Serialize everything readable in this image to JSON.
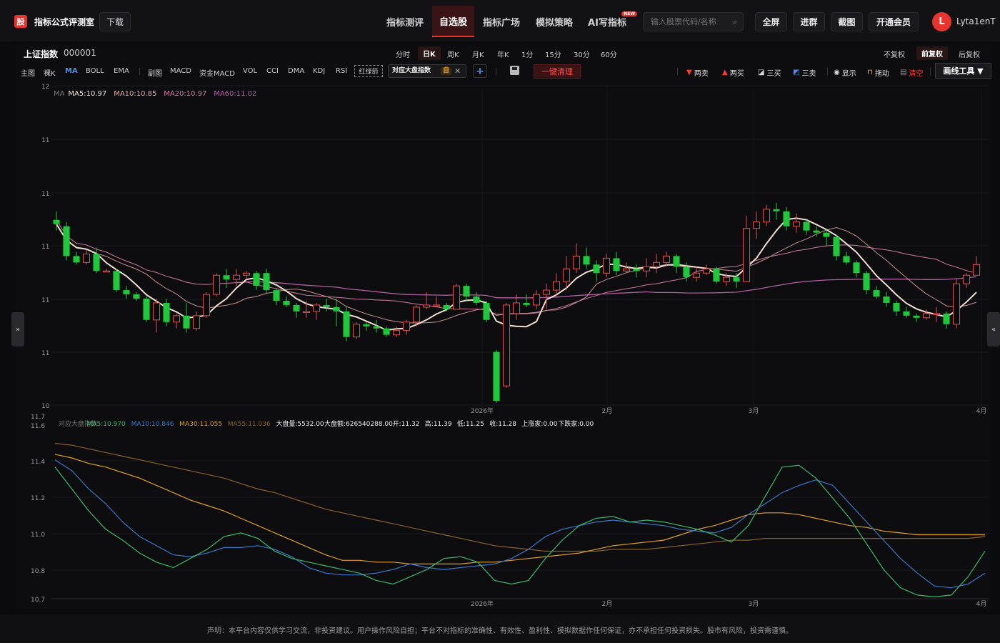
{
  "app": {
    "badge": "股",
    "title": "指标公式评测室",
    "download": "下载"
  },
  "nav": [
    {
      "label": "指标测评",
      "active": false
    },
    {
      "label": "自选股",
      "active": true
    },
    {
      "label": "指标广场",
      "active": false
    },
    {
      "label": "模拟策略",
      "active": false
    },
    {
      "label": "AI写指标",
      "active": false,
      "badge": "NEW"
    }
  ],
  "search": {
    "placeholder": "输入股票代码/名称"
  },
  "top_buttons": [
    "全屏",
    "进群",
    "截图",
    "开通会员"
  ],
  "user": {
    "initial": "L",
    "name": "Lyta1enT"
  },
  "index": {
    "name": "上证指数",
    "code": "000001"
  },
  "periods": [
    {
      "label": "分时",
      "active": false
    },
    {
      "label": "日K",
      "active": true
    },
    {
      "label": "周K",
      "active": false
    },
    {
      "label": "月K",
      "active": false
    },
    {
      "label": "年K",
      "active": false
    },
    {
      "label": "1分",
      "active": false
    },
    {
      "label": "15分",
      "active": false
    },
    {
      "label": "30分",
      "active": false
    },
    {
      "label": "60分",
      "active": false
    }
  ],
  "adjust": [
    {
      "label": "不复权",
      "active": false
    },
    {
      "label": "前复权",
      "active": true
    },
    {
      "label": "后复权",
      "active": false
    }
  ],
  "main_indicators": [
    "主图",
    "裸K",
    "MA",
    "BOLL",
    "EMA"
  ],
  "main_active": "MA",
  "sub_indicators": [
    "副图",
    "MACD",
    "资金MACD",
    "VOL",
    "CCI",
    "DMA",
    "KDJ",
    "RSI"
  ],
  "red_green": "红绿箭",
  "compare_tag": {
    "label": "对应大盘指数",
    "badge": "自"
  },
  "clear_button": "一键清理",
  "tools": [
    {
      "icon": "▼",
      "label": "两卖",
      "color": "#ff3b30"
    },
    {
      "icon": "▲",
      "label": "两买",
      "color": "#ff3b30"
    },
    {
      "icon": "⧄",
      "label": "三买",
      "color": "#ddd"
    },
    {
      "icon": "⧅",
      "label": "三卖",
      "color": "#4d8fe8"
    },
    {
      "icon": "◉",
      "label": "显示",
      "color": "#ddd"
    },
    {
      "icon": "🔓",
      "label": "拖动",
      "color": "#f0c040"
    },
    {
      "icon": "🗑",
      "label": "清空",
      "color": "#ff3b30"
    }
  ],
  "draw_tools": "画线工具 ▼",
  "main_chart": {
    "legend": [
      {
        "label": "MA",
        "color": "#777"
      },
      {
        "label": "MA5:10.97",
        "color": "#f0e0d8"
      },
      {
        "label": "MA10:10.85",
        "color": "#e0a8a8"
      },
      {
        "label": "MA20:10.97",
        "color": "#d07aa0"
      },
      {
        "label": "MA60:11.02",
        "color": "#b060a0"
      }
    ],
    "y_ticks": [
      "12",
      "11",
      "11",
      "11",
      "11",
      "11",
      "10"
    ],
    "x_ticks": [
      "2026年",
      "2月",
      "3月",
      "4月"
    ]
  },
  "sub_chart": {
    "legend": [
      {
        "label": "对应大盘指数",
        "color": "#777"
      },
      {
        "label": "MA5:10.970",
        "color": "#3ab86a"
      },
      {
        "label": "MA10:10.846",
        "color": "#3a78c8"
      },
      {
        "label": "MA30:11.055",
        "color": "#e0a020"
      },
      {
        "label": "MA55:11.036",
        "color": "#8a6030"
      },
      {
        "label": "大盘量:5532.00",
        "color": "#eee"
      },
      {
        "label": "大盘额:626540288.00",
        "color": "#eee"
      },
      {
        "label": "开:11.32",
        "color": "#eee"
      },
      {
        "label": "高:11.39",
        "color": "#eee"
      },
      {
        "label": "低:11.25",
        "color": "#eee"
      },
      {
        "label": "收:11.28",
        "color": "#eee"
      },
      {
        "label": "上涨家:0.00",
        "color": "#eee"
      },
      {
        "label": "下跌家:0.00",
        "color": "#eee"
      }
    ],
    "y_ticks": [
      "11.7",
      "11.6",
      "11.4",
      "11.2",
      "11.0",
      "10.8",
      "10.7"
    ],
    "x_ticks": [
      "2026年",
      "2月",
      "3月",
      "4月"
    ]
  },
  "disclaimer": "声明：本平台内容仅供学习交流，非投资建议。用户操作风险自担；平台不对指标的准确性、有效性、盈利性、模拟数据作任何保证，亦不承担任何投资损失。股市有风险，投资需谨慎。",
  "chart_data": [
    {
      "type": "candlestick",
      "title": "上证指数 000001",
      "y_range": [
        10.5,
        12.0
      ],
      "x_labels": [
        "2026年",
        "2月",
        "3月",
        "4月"
      ],
      "candles": [
        [
          11.37,
          11.35,
          11.41,
          11.32
        ],
        [
          11.34,
          11.2,
          11.36,
          11.18
        ],
        [
          11.2,
          11.17,
          11.22,
          11.16
        ],
        [
          11.17,
          11.21,
          11.23,
          11.16
        ],
        [
          11.21,
          11.13,
          11.24,
          11.12
        ],
        [
          11.13,
          11.13,
          11.14,
          11.13
        ],
        [
          11.13,
          11.04,
          11.14,
          11.03
        ],
        [
          11.04,
          11.02,
          11.06,
          11.0
        ],
        [
          11.02,
          11.0,
          11.03,
          10.99
        ],
        [
          11.0,
          10.9,
          11.01,
          10.89
        ],
        [
          10.9,
          10.98,
          11.0,
          10.84
        ],
        [
          10.98,
          10.89,
          11.0,
          10.87
        ],
        [
          10.89,
          10.92,
          10.93,
          10.86
        ],
        [
          10.92,
          10.86,
          10.98,
          10.84
        ],
        [
          10.86,
          10.92,
          10.94,
          10.85
        ],
        [
          10.92,
          11.02,
          11.03,
          10.91
        ],
        [
          11.02,
          11.11,
          11.12,
          11.01
        ],
        [
          11.11,
          11.09,
          11.14,
          11.05
        ],
        [
          11.09,
          11.11,
          11.14,
          11.06
        ],
        [
          11.11,
          11.12,
          11.13,
          11.09
        ],
        [
          11.12,
          11.06,
          11.13,
          11.04
        ],
        [
          11.12,
          11.04,
          11.14,
          11.02
        ],
        [
          11.04,
          10.99,
          11.05,
          10.97
        ],
        [
          10.99,
          10.97,
          11.01,
          10.96
        ],
        [
          10.97,
          10.94,
          10.98,
          10.91
        ],
        [
          10.94,
          10.94,
          10.99,
          10.91
        ],
        [
          10.94,
          10.97,
          10.98,
          10.9
        ],
        [
          10.97,
          10.96,
          11.0,
          10.94
        ],
        [
          10.96,
          10.94,
          11.0,
          10.87
        ],
        [
          10.94,
          10.82,
          10.96,
          10.8
        ],
        [
          10.82,
          10.88,
          10.89,
          10.81
        ],
        [
          10.88,
          10.87,
          10.89,
          10.85
        ],
        [
          10.87,
          10.86,
          10.9,
          10.84
        ],
        [
          10.86,
          10.83,
          10.87,
          10.82
        ],
        [
          10.83,
          10.85,
          10.87,
          10.82
        ],
        [
          10.85,
          10.89,
          10.9,
          10.83
        ],
        [
          10.89,
          10.96,
          10.97,
          10.87
        ],
        [
          10.96,
          10.97,
          11.03,
          10.95
        ],
        [
          10.97,
          10.97,
          11.01,
          10.96
        ],
        [
          10.97,
          10.95,
          10.98,
          10.94
        ],
        [
          10.95,
          11.06,
          11.07,
          10.96
        ],
        [
          11.06,
          11.01,
          11.07,
          10.99
        ],
        [
          11.01,
          10.98,
          11.03,
          10.97
        ],
        [
          10.98,
          10.9,
          10.99,
          10.89
        ],
        [
          10.75,
          10.52,
          10.76,
          10.51
        ],
        [
          10.59,
          10.97,
          10.98,
          10.58
        ],
        [
          10.93,
          10.98,
          11.02,
          10.9
        ],
        [
          10.98,
          10.97,
          11.02,
          10.96
        ],
        [
          10.97,
          11.02,
          11.04,
          10.95
        ],
        [
          11.02,
          11.04,
          11.07,
          10.95
        ],
        [
          11.04,
          11.08,
          11.12,
          11.01
        ],
        [
          11.08,
          11.14,
          11.2,
          11.04
        ],
        [
          11.14,
          11.2,
          11.26,
          11.12
        ],
        [
          11.2,
          11.16,
          11.24,
          11.14
        ],
        [
          11.16,
          11.12,
          11.18,
          11.08
        ],
        [
          11.12,
          11.19,
          11.21,
          11.1
        ],
        [
          11.19,
          11.13,
          11.22,
          11.11
        ],
        [
          11.13,
          11.14,
          11.17,
          11.12
        ],
        [
          11.14,
          11.13,
          11.16,
          11.1
        ],
        [
          11.13,
          11.15,
          11.19,
          11.1
        ],
        [
          11.15,
          11.17,
          11.21,
          11.12
        ],
        [
          11.17,
          11.2,
          11.22,
          11.15
        ],
        [
          11.2,
          11.15,
          11.21,
          11.12
        ],
        [
          11.15,
          11.1,
          11.17,
          11.08
        ],
        [
          11.1,
          11.12,
          11.15,
          11.08
        ],
        [
          11.12,
          11.14,
          11.16,
          11.11
        ],
        [
          11.14,
          11.08,
          11.15,
          11.07
        ],
        [
          11.08,
          11.1,
          11.12,
          11.06
        ],
        [
          11.1,
          11.08,
          11.12,
          11.05
        ],
        [
          11.08,
          11.33,
          11.39,
          11.24
        ],
        [
          11.33,
          11.36,
          11.41,
          11.28
        ],
        [
          11.36,
          11.42,
          11.44,
          11.34
        ],
        [
          11.42,
          11.41,
          11.45,
          11.37
        ],
        [
          11.41,
          11.34,
          11.43,
          11.32
        ],
        [
          11.34,
          11.36,
          11.4,
          11.31
        ],
        [
          11.36,
          11.32,
          11.37,
          11.3
        ],
        [
          11.32,
          11.31,
          11.34,
          11.29
        ],
        [
          11.31,
          11.29,
          11.33,
          11.25
        ],
        [
          11.29,
          11.2,
          11.3,
          11.18
        ],
        [
          11.2,
          11.17,
          11.22,
          11.16
        ],
        [
          11.17,
          11.12,
          11.18,
          11.1
        ],
        [
          11.12,
          11.04,
          11.13,
          11.02
        ],
        [
          11.04,
          11.01,
          11.06,
          11.0
        ],
        [
          11.01,
          10.98,
          11.03,
          10.96
        ],
        [
          10.98,
          10.94,
          10.99,
          10.92
        ],
        [
          10.94,
          10.92,
          10.96,
          10.91
        ],
        [
          10.92,
          10.91,
          10.93,
          10.89
        ],
        [
          10.91,
          10.93,
          10.95,
          10.9
        ],
        [
          10.93,
          10.93,
          10.96,
          10.89
        ],
        [
          10.93,
          10.88,
          10.94,
          10.86
        ],
        [
          10.88,
          11.07,
          11.09,
          10.86
        ],
        [
          11.07,
          11.11,
          11.12,
          11.05
        ],
        [
          11.11,
          11.16,
          11.2,
          11.11
        ]
      ]
    },
    {
      "type": "line",
      "title": "对应大盘指数",
      "y_range": [
        10.7,
        11.7
      ],
      "series": [
        {
          "name": "MA5",
          "color": "#3ab86a",
          "values": [
            11.42,
            11.3,
            11.18,
            11.08,
            11.02,
            10.95,
            10.9,
            10.87,
            10.92,
            10.97,
            11.04,
            11.06,
            11.03,
            10.96,
            10.92,
            10.9,
            10.88,
            10.86,
            10.84,
            10.8,
            10.78,
            10.82,
            10.86,
            10.92,
            10.93,
            10.9,
            10.8,
            10.78,
            10.8,
            10.92,
            11.02,
            11.1,
            11.14,
            11.15,
            11.12,
            11.13,
            11.12,
            11.1,
            11.08,
            11.05,
            11.01,
            11.1,
            11.26,
            11.42,
            11.43,
            11.36,
            11.25,
            11.14,
            11.0,
            10.86,
            10.76,
            10.72,
            10.71,
            10.72,
            10.82,
            10.96
          ]
        },
        {
          "name": "MA10",
          "color": "#3a78c8",
          "values": [
            11.46,
            11.4,
            11.3,
            11.22,
            11.12,
            11.04,
            10.99,
            10.94,
            10.93,
            10.95,
            10.98,
            10.98,
            10.99,
            10.97,
            10.93,
            10.87,
            10.84,
            10.83,
            10.83,
            10.84,
            10.86,
            10.89,
            10.87,
            10.86,
            10.87,
            10.88,
            10.89,
            10.92,
            10.97,
            11.04,
            11.08,
            11.1,
            11.12,
            11.13,
            11.12,
            11.11,
            11.1,
            11.08,
            11.07,
            11.06,
            11.09,
            11.16,
            11.22,
            11.28,
            11.32,
            11.35,
            11.32,
            11.22,
            11.12,
            11.02,
            10.92,
            10.84,
            10.77,
            10.76,
            10.78,
            10.84
          ]
        },
        {
          "name": "MA30",
          "color": "#e0a020",
          "values": [
            11.49,
            11.47,
            11.44,
            11.42,
            11.39,
            11.36,
            11.32,
            11.28,
            11.24,
            11.21,
            11.18,
            11.14,
            11.1,
            11.06,
            11.02,
            10.98,
            10.94,
            10.91,
            10.91,
            10.9,
            10.9,
            10.89,
            10.89,
            10.89,
            10.89,
            10.9,
            10.9,
            10.91,
            10.92,
            10.93,
            10.94,
            10.95,
            10.97,
            10.99,
            11.0,
            11.01,
            11.02,
            11.05,
            11.08,
            11.1,
            11.13,
            11.16,
            11.17,
            11.17,
            11.16,
            11.14,
            11.12,
            11.1,
            11.09,
            11.07,
            11.06,
            11.05,
            11.05,
            11.05,
            11.05,
            11.05
          ]
        },
        {
          "name": "MA55",
          "color": "#8a6030",
          "values": [
            11.55,
            11.54,
            11.52,
            11.5,
            11.48,
            11.46,
            11.44,
            11.42,
            11.4,
            11.38,
            11.36,
            11.33,
            11.3,
            11.28,
            11.25,
            11.22,
            11.19,
            11.17,
            11.15,
            11.13,
            11.11,
            11.09,
            11.07,
            11.05,
            11.03,
            11.01,
            10.99,
            10.98,
            10.97,
            10.96,
            10.96,
            10.96,
            10.96,
            10.97,
            10.97,
            10.97,
            10.98,
            10.99,
            11.0,
            11.01,
            11.02,
            11.02,
            11.03,
            11.03,
            11.03,
            11.03,
            11.03,
            11.03,
            11.03,
            11.03,
            11.03,
            11.03,
            11.03,
            11.03,
            11.03,
            11.04
          ]
        }
      ]
    }
  ]
}
